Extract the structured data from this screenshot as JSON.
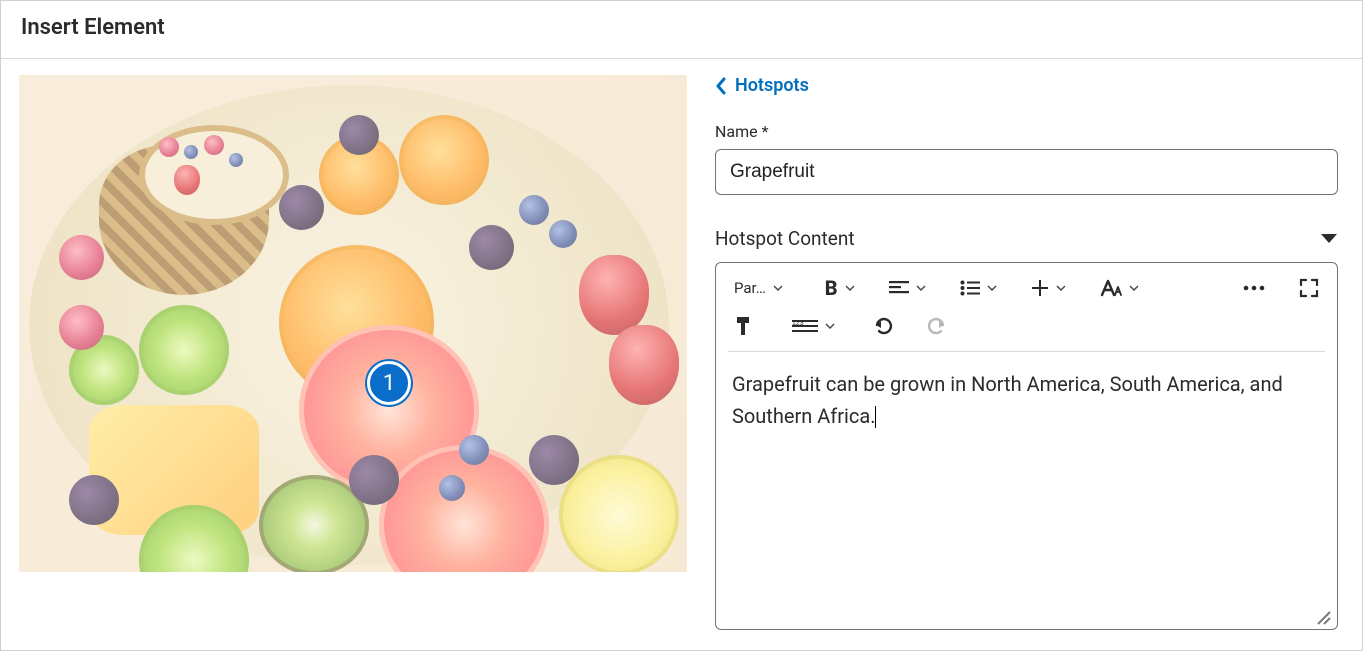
{
  "header": {
    "title": "Insert Element"
  },
  "breadcrumb": {
    "label": "Hotspots"
  },
  "hotspot_marker": {
    "number": "1"
  },
  "name_field": {
    "label": "Name *",
    "value": "Grapefruit"
  },
  "content_section": {
    "label": "Hotspot Content"
  },
  "toolbar": {
    "paragraph_label": "Par…",
    "bold_tooltip": "Bold",
    "align_tooltip": "Align",
    "list_tooltip": "Lists",
    "insert_tooltip": "Insert",
    "font_tooltip": "Font",
    "more_tooltip": "More actions",
    "fullscreen_tooltip": "Fullscreen",
    "format_painter_tooltip": "Format Painter",
    "line_style_tooltip": "Line",
    "undo_tooltip": "Undo",
    "redo_tooltip": "Redo"
  },
  "editor_body": {
    "text": "Grapefruit can be grown in North America, South America, and Southern Africa."
  }
}
